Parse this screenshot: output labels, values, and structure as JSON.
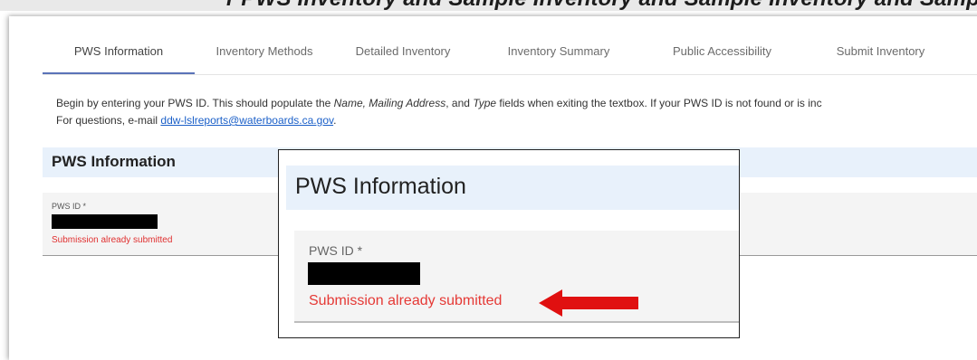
{
  "top_strip_text": "r PWS Inventory and Sample Inventory and Sample Inventory and Sampl",
  "tabs": [
    {
      "label": "PWS Information",
      "active": true
    },
    {
      "label": "Inventory Methods",
      "active": false
    },
    {
      "label": "Detailed Inventory",
      "active": false
    },
    {
      "label": "Inventory Summary",
      "active": false
    },
    {
      "label": "Public Accessibility",
      "active": false
    },
    {
      "label": "Submit Inventory",
      "active": false
    }
  ],
  "intro": {
    "part1": "Begin by entering your PWS ID. This should populate the ",
    "italic1": "Name, Mailing Address",
    "part2": ", and ",
    "italic2": "Type",
    "part3": " fields when exiting the textbox. If your PWS ID is not found or is inc",
    "line2_prefix": "For questions, e-mail ",
    "email": "ddw-lslreports@waterboards.ca.gov",
    "line2_suffix": "."
  },
  "section": {
    "title": "PWS Information"
  },
  "field": {
    "label": "PWS ID *",
    "value": "[redacted]",
    "error": "Submission already submitted"
  },
  "callout": {
    "title": "PWS Information",
    "label": "PWS ID *",
    "error": "Submission already submitted",
    "arrow_color": "#e01010"
  },
  "colors": {
    "accent": "#5a73b8",
    "error": "#e53935",
    "section_bg": "#e8f1fb",
    "link": "#1a5fc8"
  }
}
